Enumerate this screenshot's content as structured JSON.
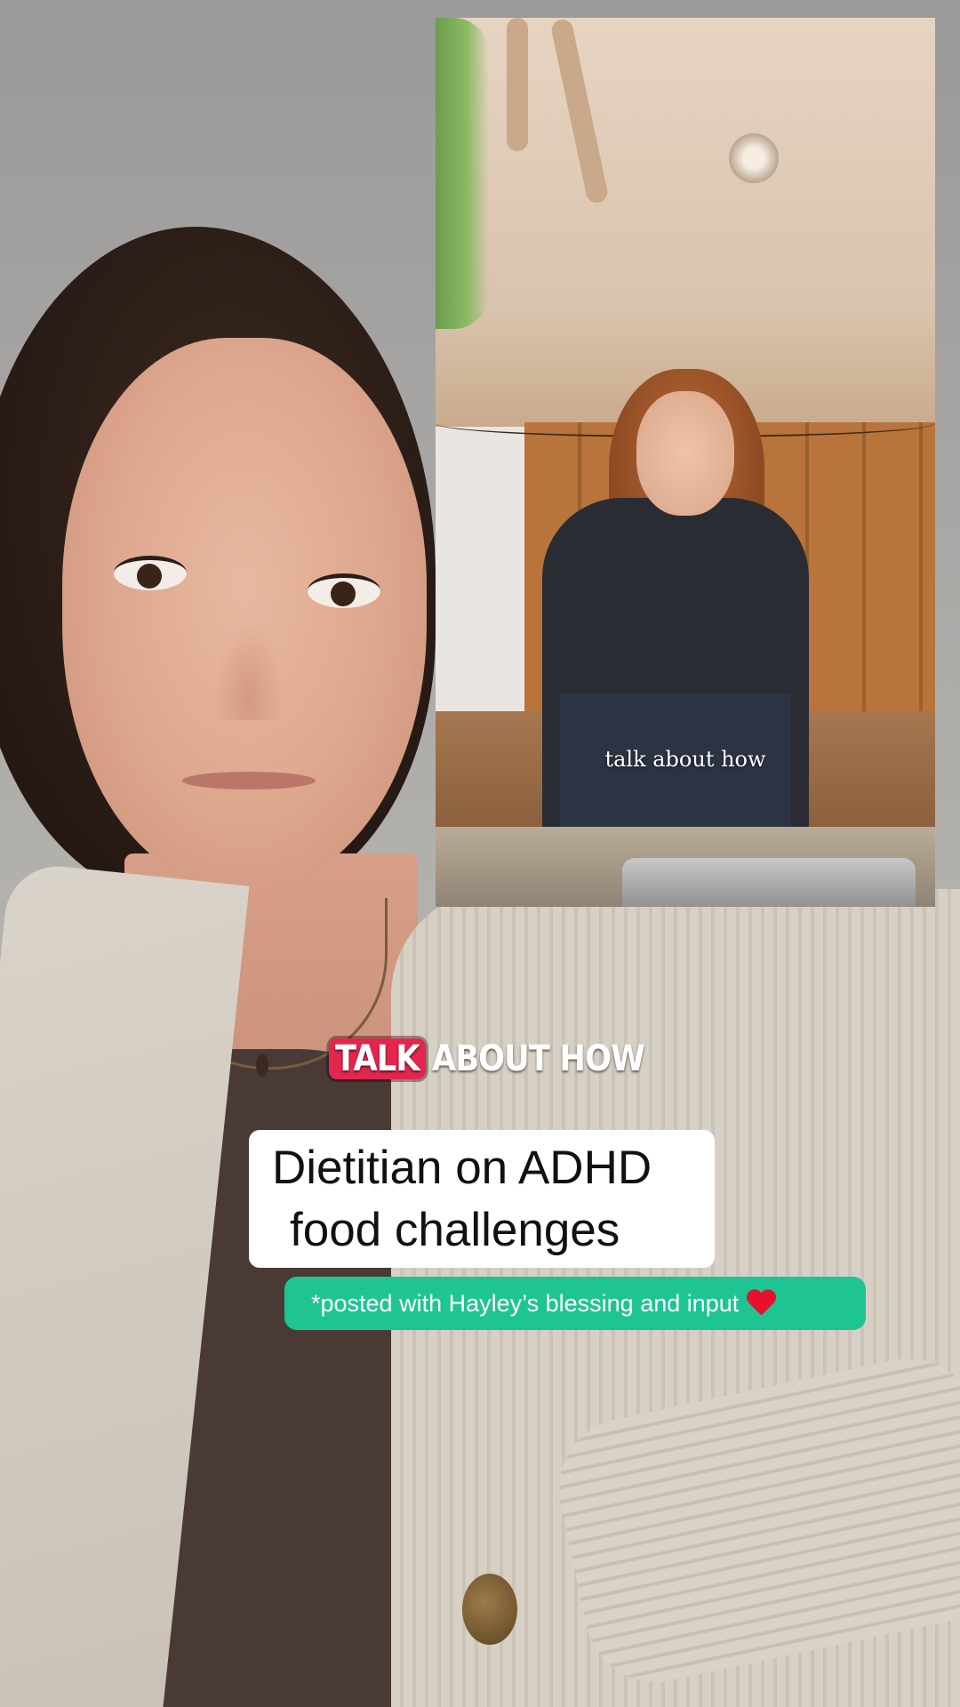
{
  "inset_video": {
    "caption": "talk about how"
  },
  "overlay": {
    "subtitle_highlight": "TALK",
    "subtitle_rest": "ABOUT HOW",
    "title_line1": "Dietitian on ADHD",
    "title_line2": "food challenges",
    "note": "*posted with Hayley’s blessing and input",
    "note_icon": "heart-icon"
  },
  "colors": {
    "subtitle_highlight": "#e2264d",
    "note_pill": "#1ec593",
    "title_card": "#ffffff"
  }
}
